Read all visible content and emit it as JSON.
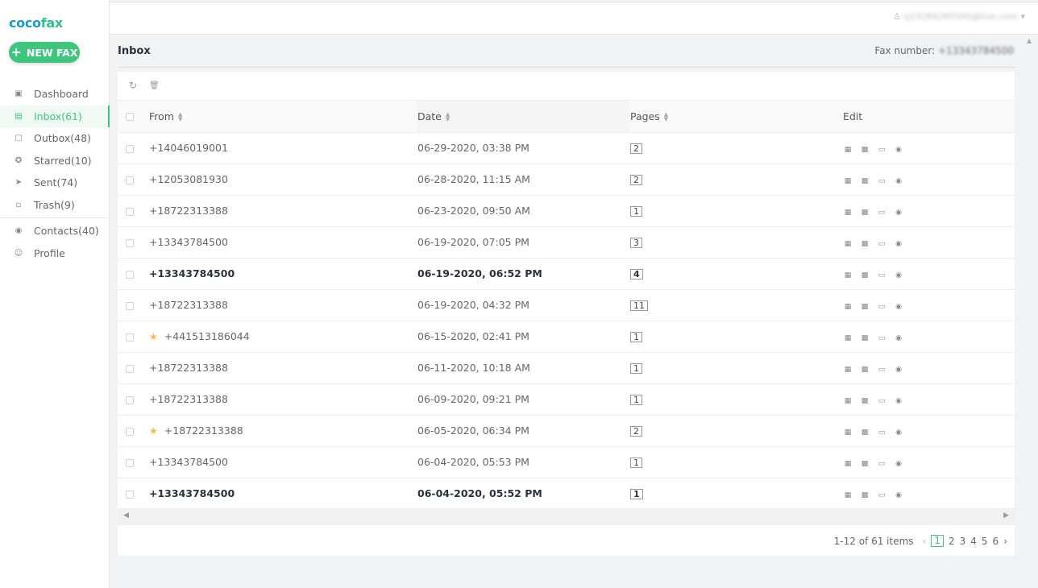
{
  "app": {
    "logo_part1": "coco",
    "logo_part2": "fax",
    "new_fax_label": "NEW FAX"
  },
  "sidebar": {
    "items": [
      {
        "label": "Dashboard",
        "icon": "monitor-icon",
        "active": false
      },
      {
        "label": "Inbox(61)",
        "icon": "inbox-icon",
        "active": true
      },
      {
        "label": "Outbox(48)",
        "icon": "file-icon",
        "active": false
      },
      {
        "label": "Starred(10)",
        "icon": "star-outline-icon",
        "active": false
      },
      {
        "label": "Sent(74)",
        "icon": "send-icon",
        "active": false
      },
      {
        "label": "Trash(9)",
        "icon": "trash-icon",
        "active": false
      }
    ],
    "items2": [
      {
        "label": "Contacts(40)",
        "icon": "contacts-icon"
      },
      {
        "label": "Profile",
        "icon": "user-icon"
      }
    ]
  },
  "header": {
    "user_email": "q13284265500@live.com"
  },
  "page": {
    "title": "Inbox",
    "fax_number_label": "Fax number: ",
    "fax_number_value": "+13343784500"
  },
  "table": {
    "columns": {
      "from": "From",
      "date": "Date",
      "pages": "Pages",
      "edit": "Edit"
    },
    "rows": [
      {
        "from": "+14046019001",
        "date": "06-29-2020, 03:38 PM",
        "pages": "2",
        "starred": false,
        "unread": false
      },
      {
        "from": "+12053081930",
        "date": "06-28-2020, 11:15 AM",
        "pages": "2",
        "starred": false,
        "unread": false
      },
      {
        "from": "+18722313388",
        "date": "06-23-2020, 09:50 AM",
        "pages": "1",
        "starred": false,
        "unread": false
      },
      {
        "from": "+13343784500",
        "date": "06-19-2020, 07:05 PM",
        "pages": "3",
        "starred": false,
        "unread": false
      },
      {
        "from": "+13343784500",
        "date": "06-19-2020, 06:52 PM",
        "pages": "4",
        "starred": false,
        "unread": true
      },
      {
        "from": "+18722313388",
        "date": "06-19-2020, 04:32 PM",
        "pages": "11",
        "starred": false,
        "unread": false
      },
      {
        "from": "+441513186044",
        "date": "06-15-2020, 02:41 PM",
        "pages": "1",
        "starred": true,
        "unread": false
      },
      {
        "from": "+18722313388",
        "date": "06-11-2020, 10:18 AM",
        "pages": "1",
        "starred": false,
        "unread": false
      },
      {
        "from": "+18722313388",
        "date": "06-09-2020, 09:21 PM",
        "pages": "1",
        "starred": false,
        "unread": false
      },
      {
        "from": "+18722313388",
        "date": "06-05-2020, 06:34 PM",
        "pages": "2",
        "starred": true,
        "unread": false
      },
      {
        "from": "+13343784500",
        "date": "06-04-2020, 05:53 PM",
        "pages": "1",
        "starred": false,
        "unread": false
      },
      {
        "from": "+13343784500",
        "date": "06-04-2020, 05:52 PM",
        "pages": "1",
        "starred": false,
        "unread": true
      }
    ]
  },
  "pagination": {
    "summary": "1-12 of 61 items",
    "pages": [
      "1",
      "2",
      "3",
      "4",
      "5",
      "6"
    ],
    "current": "1"
  },
  "colors": {
    "accent": "#3ec67d",
    "logo_blue": "#1a9cc9",
    "star": "#f5b942"
  }
}
